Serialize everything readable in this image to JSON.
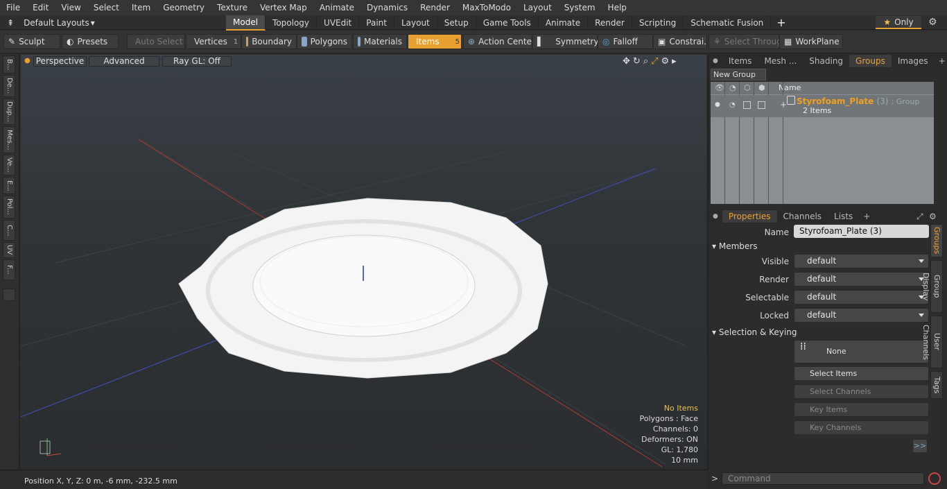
{
  "menu": [
    "File",
    "Edit",
    "View",
    "Select",
    "Item",
    "Geometry",
    "Texture",
    "Vertex Map",
    "Animate",
    "Dynamics",
    "Render",
    "MaxToModo",
    "Layout",
    "System",
    "Help"
  ],
  "layouts_label": "Default Layouts",
  "mode_tabs": [
    "Model",
    "Topology",
    "UVEdit",
    "Paint",
    "Layout",
    "Setup",
    "Game Tools",
    "Animate",
    "Render",
    "Scripting",
    "Schematic Fusion"
  ],
  "only_label": "Only",
  "toolbar": {
    "sculpt": "Sculpt",
    "presets": "Presets",
    "auto_select": "Auto Select",
    "vertices": "Vertices",
    "vertices_count": "1",
    "boundary": "Boundary",
    "polygons": "Polygons",
    "materials": "Materials",
    "items": "Items",
    "items_count": "5",
    "action_center": "Action Center",
    "symmetry": "Symmetry",
    "falloff": "Falloff",
    "constraints": "Constrai...",
    "select_through": "Select Through",
    "workplane": "WorkPlane"
  },
  "left_tabs": [
    "B...",
    "De...",
    "Dup...",
    "Mes...",
    "Ve...",
    "E...",
    "Pol...",
    "C...",
    "UV",
    "F..."
  ],
  "viewport": {
    "perspective": "Perspective",
    "advanced": "Advanced",
    "raygl": "Ray GL: Off"
  },
  "stats": {
    "items": "No Items",
    "polygons": "Polygons : Face",
    "channels": "Channels: 0",
    "deformers": "Deformers: ON",
    "gl": "GL: 1,780",
    "scale": "10 mm"
  },
  "status_position": "Position X, Y, Z:   0 m, -6 mm, -232.5 mm",
  "panel_tabs": [
    "Items",
    "Mesh ...",
    "Shading",
    "Groups",
    "Images"
  ],
  "new_group": "New Group",
  "group_name_header": "Name",
  "group_item": {
    "name": "Styrofoam_Plate",
    "count": "(3)",
    "type": ": Group",
    "sub": "2 Items"
  },
  "prop_tabs": [
    "Properties",
    "Channels",
    "Lists"
  ],
  "props": {
    "name_label": "Name",
    "name_value": "Styrofoam_Plate (3)",
    "members": "Members",
    "visible_label": "Visible",
    "visible": "default",
    "render_label": "Render",
    "render": "default",
    "selectable_label": "Selectable",
    "selectable": "default",
    "locked_label": "Locked",
    "locked": "default",
    "selkey": "Selection & Keying",
    "none": "None",
    "select_items": "Select Items",
    "select_channels": "Select Channels",
    "key_items": "Key Items",
    "key_channels": "Key Channels",
    "more": ">>"
  },
  "side_tabs": [
    "Groups",
    "Group Display",
    "User Channels",
    "Tags"
  ],
  "command_placeholder": "Command"
}
